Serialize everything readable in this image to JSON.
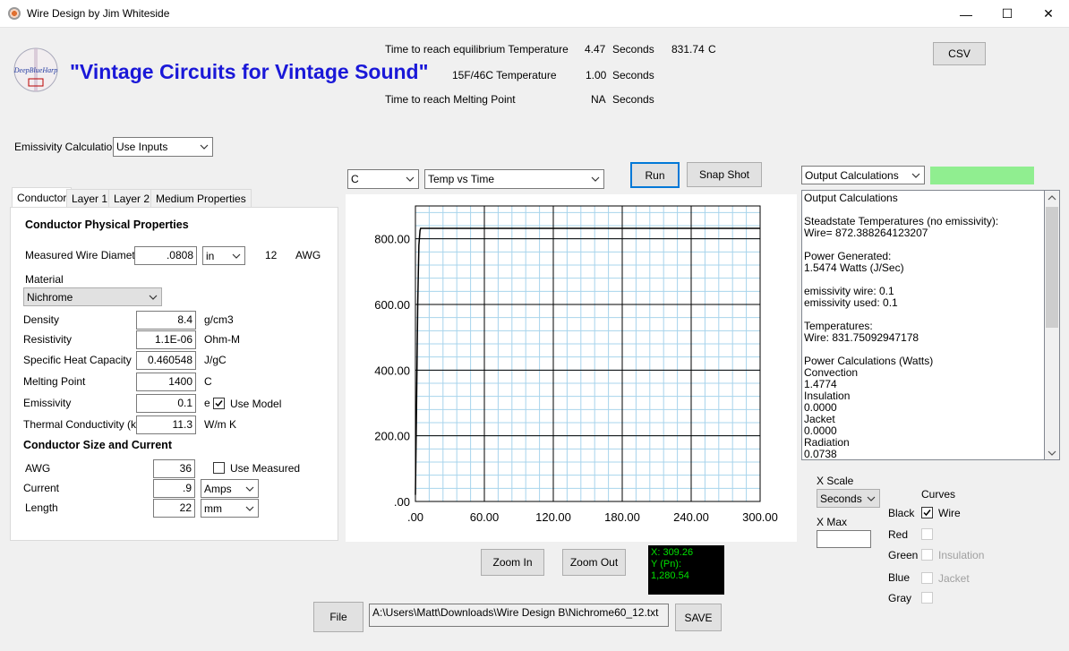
{
  "window": {
    "title": "Wire Design by Jim Whiteside",
    "minimize": "—",
    "maximize": "☐",
    "close": "✕"
  },
  "header": {
    "logo_text": "DeepBlueHarp",
    "slogan": "\"Vintage Circuits for Vintage Sound\"",
    "eq_label": "Time to reach equilibrium Temperature",
    "eq_value": "4.47",
    "eq_unit": "Seconds",
    "eq_temp": "831.74",
    "eq_temp_unit": "C",
    "t15_label": "15F/46C Temperature",
    "t15_value": "1.00",
    "t15_unit": "Seconds",
    "melt_label": "Time to reach Melting Point",
    "melt_value": "NA",
    "melt_unit": "Seconds",
    "csv_label": "CSV"
  },
  "emissivity": {
    "label": "Emissivity Calculation",
    "value": "Use Inputs"
  },
  "tabs": [
    "Conductor",
    "Layer 1",
    "Layer 2",
    "Medium Properties"
  ],
  "conductor": {
    "heading": "Conductor Physical Properties",
    "diameter_label": "Measured Wire Diameter",
    "diameter_value": ".0808",
    "diameter_unit": "in",
    "awg_value": "12",
    "awg_label": "AWG",
    "material_label": "Material",
    "material_value": "Nichrome",
    "density_label": "Density",
    "density_value": "8.4",
    "density_unit": "g/cm3",
    "resistivity_label": "Resistivity",
    "resistivity_value": "1.1E-06",
    "resistivity_unit": "Ohm-M",
    "heat_label": "Specific Heat Capacity",
    "heat_value": "0.460548",
    "heat_unit": "J/gC",
    "melting_label": "Melting Point",
    "melting_value": "1400",
    "melting_unit": "C",
    "emissivity_label": "Emissivity",
    "emissivity_value": "0.1",
    "emissivity_unit": "e",
    "use_model_label": "Use Model",
    "thermal_label": "Thermal Conductivity (k)",
    "thermal_value": "11.3",
    "thermal_unit": "W/m K",
    "size_heading": "Conductor Size and Current",
    "awg2_label": "AWG",
    "awg2_value": "36",
    "use_measured_label": "Use Measured",
    "current_label": "Current",
    "current_value": ".9",
    "current_unit": "Amps",
    "length_label": "Length",
    "length_value": "22",
    "length_unit": "mm"
  },
  "chart_controls": {
    "unit_value": "C",
    "mode_value": "Temp vs Time",
    "run_label": "Run",
    "snapshot_label": "Snap Shot",
    "zoom_in_label": "Zoom In",
    "zoom_out_label": "Zoom Out"
  },
  "coords": {
    "x": "X: 309.26",
    "y": "Y (Pn): 1,280.54"
  },
  "output": {
    "select_value": "Output Calculations",
    "status_color": "#90ee90",
    "text": "Output Calculations\n\nSteadstate Temperatures (no emissivity):\nWire= 872.388264123207\n\nPower Generated:\n1.5474 Watts (J/Sec)\n\nemissivity wire: 0.1\nemissivity used: 0.1\n\nTemperatures:\nWire: 831.75092947178\n\nPower Calculations (Watts)\nConvection\n1.4774\nInsulation\n0.0000\nJacket\n0.0000\nRadiation\n0.0738"
  },
  "scale": {
    "x_scale_label": "X Scale",
    "x_scale_value": "Seconds",
    "x_max_label": "X Max",
    "x_max_value": "",
    "curves_label": "Curves",
    "black_label": "Black",
    "wire_label": "Wire",
    "red_label": "Red",
    "green_label": "Green",
    "insulation_label": "Insulation",
    "blue_label": "Blue",
    "jacket_label": "Jacket",
    "gray_label": "Gray"
  },
  "footer": {
    "file_label": "File",
    "path_value": "A:\\Users\\Matt\\Downloads\\Wire Design B\\Nichrome60_12.txt",
    "save_label": "SAVE"
  },
  "chart_data": {
    "type": "line",
    "xlim": [
      0,
      300
    ],
    "ylim": [
      0,
      900
    ],
    "x_ticks": [
      ".00",
      "60.00",
      "120.00",
      "180.00",
      "240.00",
      "300.00"
    ],
    "y_ticks": [
      ".00",
      "200.00",
      "400.00",
      "600.00",
      "800.00"
    ],
    "grid": true,
    "series": [
      {
        "color": "#000000",
        "x": [
          0,
          1,
          2,
          3,
          4,
          4.5,
          300
        ],
        "y": [
          20,
          300,
          600,
          780,
          825,
          831.74,
          831.74
        ]
      }
    ]
  }
}
